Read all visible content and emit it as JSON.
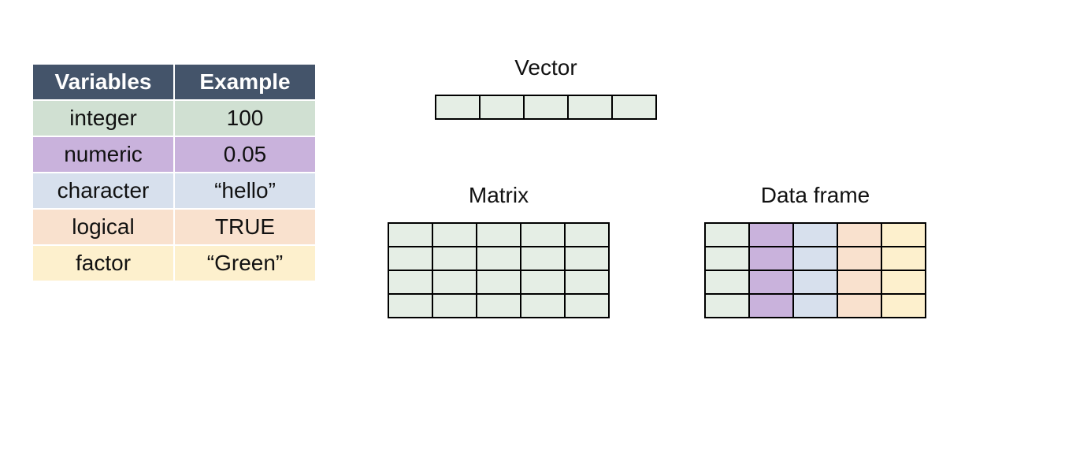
{
  "table": {
    "headers": {
      "col1": "Variables",
      "col2": "Example"
    },
    "rows": [
      {
        "variable": "integer",
        "example": "100",
        "color": "#d0e0d2"
      },
      {
        "variable": "numeric",
        "example": "0.05",
        "color": "#c9b2dc"
      },
      {
        "variable": "character",
        "example": "“hello”",
        "color": "#d7e0ed"
      },
      {
        "variable": "logical",
        "example": "TRUE",
        "color": "#f9e1ce"
      },
      {
        "variable": "factor",
        "example": "“Green”",
        "color": "#fdf0cd"
      }
    ]
  },
  "diagrams": {
    "vector": {
      "label": "Vector",
      "rows": 1,
      "cols": 5,
      "fill": "#e5eee5"
    },
    "matrix": {
      "label": "Matrix",
      "rows": 4,
      "cols": 5,
      "fill": "#e5eee5"
    },
    "dataframe": {
      "label": "Data frame",
      "rows": 4,
      "cols": 5,
      "column_fills": [
        "#e5eee5",
        "#c9b2dc",
        "#d7e0ed",
        "#f9e1ce",
        "#fdf0cd"
      ]
    }
  }
}
